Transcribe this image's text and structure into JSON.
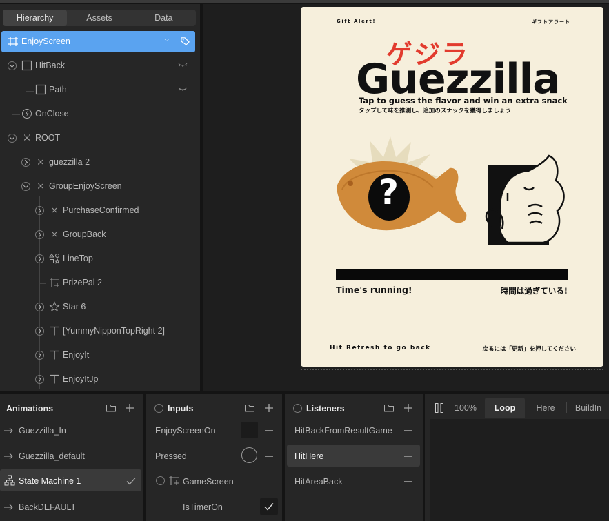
{
  "hierarchy": {
    "tabs": [
      {
        "label": "Hierarchy",
        "active": true
      },
      {
        "label": "Assets",
        "active": false
      },
      {
        "label": "Data",
        "active": false
      }
    ],
    "selected": {
      "label": "EnjoyScreen",
      "icon": "frame-icon"
    },
    "items": [
      {
        "label": "HitBack",
        "icon": "rectangle-icon"
      },
      {
        "label": "Path",
        "icon": "rectangle-icon"
      },
      {
        "label": "OnClose",
        "icon": "bolt-icon"
      },
      {
        "label": "ROOT",
        "icon": "group-icon"
      },
      {
        "label": "guezzilla 2",
        "icon": "group-icon"
      },
      {
        "label": "GroupEnjoyScreen",
        "icon": "group-icon"
      },
      {
        "label": "PurchaseConfirmed",
        "icon": "group-icon"
      },
      {
        "label": "GroupBack",
        "icon": "group-icon"
      },
      {
        "label": "LineTop",
        "icon": "shapes-icon"
      },
      {
        "label": "PrizePal 2",
        "icon": "frame-icon"
      },
      {
        "label": "Star 6",
        "icon": "star-icon"
      },
      {
        "label": "[YummyNipponTopRight 2]",
        "icon": "text-icon"
      },
      {
        "label": "EnjoyIt",
        "icon": "text-icon"
      },
      {
        "label": "EnjoyItJp",
        "icon": "text-icon"
      }
    ]
  },
  "artboard": {
    "gift_alert": "Gift Alert!",
    "gift_alert_jp": "ギフトアラート",
    "title_jp": "ゲジラ",
    "title_en": "Guezzilla",
    "tagline": "Tap to guess the flavor and win an extra snack",
    "tagline_jp": "タップして味を推測し、追加のスナックを獲得しましょう",
    "question": "?",
    "time_en": "Time's running!",
    "time_jp": "時間は過ぎている!",
    "refresh_en": "Hit Refresh to go back",
    "refresh_jp": "戻るには「更新」を押してください",
    "colors": {
      "background": "#f6efdc",
      "title_jp": "#e23b2e",
      "taiyaki": "#d08a3a"
    }
  },
  "animations": {
    "title": "Animations",
    "items": [
      {
        "label": "Guezzilla_In",
        "icon": "arrow-right-icon"
      },
      {
        "label": "Guezzilla_default",
        "icon": "arrow-right-icon"
      },
      {
        "label": "State Machine 1",
        "icon": "state-machine-icon",
        "selected": true
      },
      {
        "label": "BackDEFAULT",
        "icon": "arrow-right-icon"
      }
    ]
  },
  "inputs": {
    "title": "Inputs",
    "items": [
      {
        "label": "EnjoyScreenOn",
        "type": "number"
      },
      {
        "label": "Pressed",
        "type": "trigger"
      },
      {
        "label": "GameScreen",
        "type": "group"
      },
      {
        "label": "IsTimerOn",
        "type": "boolean",
        "checked": true
      }
    ]
  },
  "listeners": {
    "title": "Listeners",
    "items": [
      {
        "label": "HitBackFromResultGame"
      },
      {
        "label": "HitHere",
        "selected": true
      },
      {
        "label": "HitAreaBack"
      }
    ]
  },
  "timeline": {
    "zoom": "100%",
    "tabs": [
      {
        "label": "Loop",
        "active": true
      },
      {
        "label": "Here",
        "active": false
      },
      {
        "label": "BuildIn",
        "active": false
      }
    ]
  }
}
